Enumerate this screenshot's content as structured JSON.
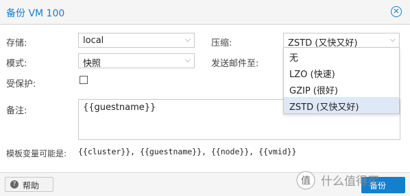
{
  "dialog": {
    "title": "备份 VM 100",
    "close_icon": "close-circle-icon"
  },
  "form": {
    "storage_label": "存储:",
    "storage_value": "local",
    "mode_label": "模式:",
    "mode_value": "快照",
    "protect_label": "受保护:",
    "protect_checked": false,
    "compress_label": "压缩:",
    "compress_value": "ZSTD (又快又好)",
    "email_label": "发送邮件至:",
    "notes_label": "备注:",
    "notes_value": "{{guestname}}",
    "template_label": "模板变量可能是:",
    "template_vars": "{{cluster}}, {{guestname}}, {{node}}, {{vmid}}"
  },
  "compress_dropdown": {
    "options": [
      "无",
      "LZO (快速)",
      "GZIP (很好)",
      "ZSTD (又快又好)"
    ],
    "selected_index": 3
  },
  "footer": {
    "help_label": "帮助",
    "backup_label": "备份"
  },
  "watermark": {
    "text": "值 什么值得买"
  },
  "colors": {
    "accent": "#157fcc",
    "dropdown_selected": "#dfe8f6"
  }
}
